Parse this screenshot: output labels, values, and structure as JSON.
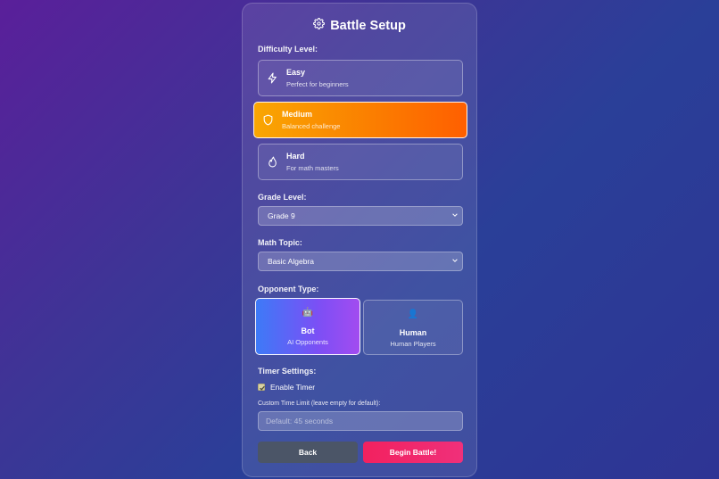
{
  "title": "Battle Setup",
  "difficulty": {
    "label": "Difficulty Level:",
    "options": [
      {
        "name": "Easy",
        "desc": "Perfect for beginners",
        "icon": "lightning-icon"
      },
      {
        "name": "Medium",
        "desc": "Balanced challenge",
        "icon": "shield-icon",
        "selected": true
      },
      {
        "name": "Hard",
        "desc": "For math masters",
        "icon": "flame-icon"
      }
    ],
    "selected_color": "#fb8a00"
  },
  "grade": {
    "label": "Grade Level:",
    "value": "Grade 9"
  },
  "topic": {
    "label": "Math Topic:",
    "value": "Basic Algebra"
  },
  "opponent": {
    "label": "Opponent Type:",
    "options": [
      {
        "name": "Bot",
        "desc": "AI Opponents",
        "emoji": "🤖",
        "selected": true
      },
      {
        "name": "Human",
        "desc": "Human Players",
        "emoji": "👤"
      }
    ]
  },
  "timer": {
    "label": "Timer Settings:",
    "enable_label": "Enable Timer",
    "enabled": true,
    "custom_label": "Custom Time Limit (leave empty for default):",
    "placeholder": "Default: 45 seconds"
  },
  "buttons": {
    "back": "Back",
    "begin": "Begin Battle!"
  },
  "colors": {
    "back_button": "#4b5567",
    "begin_button": "#f2215f",
    "bot_gradient_start": "#3d7af7",
    "bot_gradient_end": "#a24cf0"
  }
}
